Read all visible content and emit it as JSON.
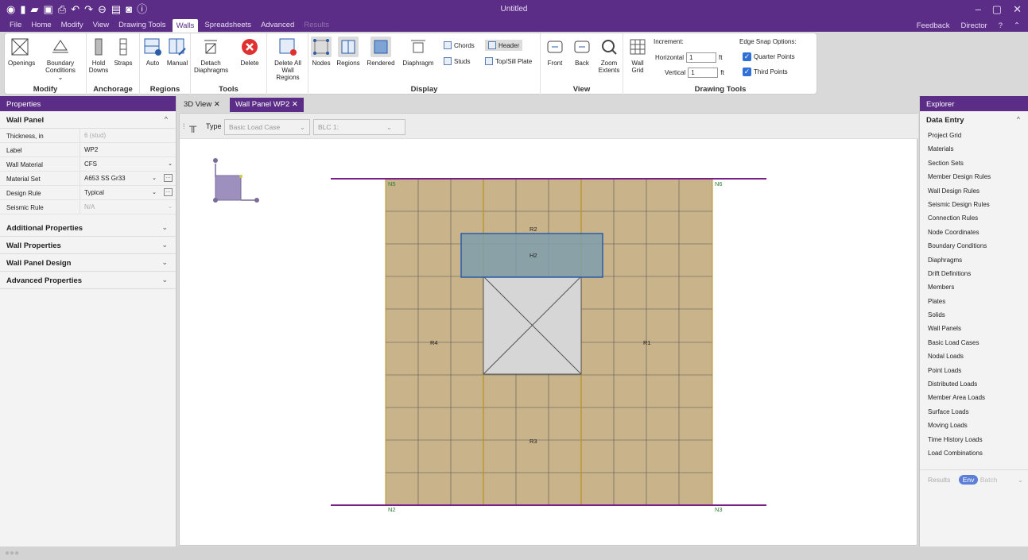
{
  "app": {
    "title": "Untitled"
  },
  "menus": [
    "File",
    "Home",
    "Modify",
    "View",
    "Drawing Tools",
    "Walls",
    "Spreadsheets",
    "Advanced",
    "Results"
  ],
  "menu_active": "Walls",
  "right_menu": {
    "feedback": "Feedback",
    "director": "Director",
    "help": "?"
  },
  "ribbon": {
    "modify": {
      "label": "Modify",
      "openings": "Openings",
      "boundary": "Boundary Conditions"
    },
    "anchorage": {
      "label": "Anchorage",
      "hold": "Hold Downs",
      "straps": "Straps"
    },
    "regions": {
      "label": "Regions",
      "auto": "Auto",
      "manual": "Manual"
    },
    "tools": {
      "label": "Tools",
      "detach": "Detach Diaphragms",
      "delete": "Delete",
      "delete_all": "Delete All Wall Regions"
    },
    "display": {
      "label": "Display",
      "nodes": "Nodes",
      "regions": "Regions",
      "rendered": "Rendered",
      "diaphragm": "Diaphragm",
      "chords": "Chords",
      "header": "Header",
      "studs": "Studs",
      "top_sill": "Top/Sill Plate"
    },
    "view": {
      "label": "View",
      "front": "Front",
      "back": "Back",
      "zoom": "Zoom Extents"
    },
    "drawing": {
      "label": "Drawing Tools",
      "wall_grid": "Wall Grid",
      "increment": "Increment:",
      "horizontal": "Horizontal",
      "vertical": "Vertical",
      "h_val": "1",
      "v_val": "1",
      "unit": "ft",
      "snap": "Edge Snap Options:",
      "quarter": "Quarter Points",
      "third": "Third Points"
    }
  },
  "properties": {
    "title": "Properties",
    "section": "Wall Panel",
    "rows": [
      {
        "k": "Thickness, in",
        "v": "6 (stud)"
      },
      {
        "k": "Label",
        "v": "WP2"
      },
      {
        "k": "Wall Material",
        "v": "CFS"
      },
      {
        "k": "Material Set",
        "v": "A653 SS Gr33"
      },
      {
        "k": "Design Rule",
        "v": "Typical"
      },
      {
        "k": "Seismic Rule",
        "v": "N/A"
      }
    ],
    "sections": [
      "Additional Properties",
      "Wall Properties",
      "Wall Panel Design",
      "Advanced Properties"
    ]
  },
  "tabs": {
    "t1": "3D View",
    "t2": "Wall Panel WP2"
  },
  "viewtool": {
    "type_label": "Type",
    "type_value": "Basic Load Case",
    "blc": "BLC 1:"
  },
  "drawing": {
    "nodes": [
      "N5",
      "N6",
      "N2",
      "N3"
    ],
    "regions": [
      "R2",
      "H2",
      "R4",
      "R1",
      "R3"
    ]
  },
  "explorer": {
    "title": "Explorer",
    "section": "Data Entry",
    "items": [
      "Project Grid",
      "Materials",
      "Section Sets",
      "Member Design Rules",
      "Wall Design Rules",
      "Seismic Design Rules",
      "Connection Rules",
      "Node Coordinates",
      "Boundary Conditions",
      "Diaphragms",
      "Drift Definitions",
      "Members",
      "Plates",
      "Solids",
      "Wall Panels",
      "Basic Load Cases",
      "Nodal Loads",
      "Point Loads",
      "Distributed Loads",
      "Member Area Loads",
      "Surface Loads",
      "Moving Loads",
      "Time History Loads",
      "Load Combinations"
    ],
    "results": "Results",
    "env": "Env",
    "batch": "Batch"
  }
}
